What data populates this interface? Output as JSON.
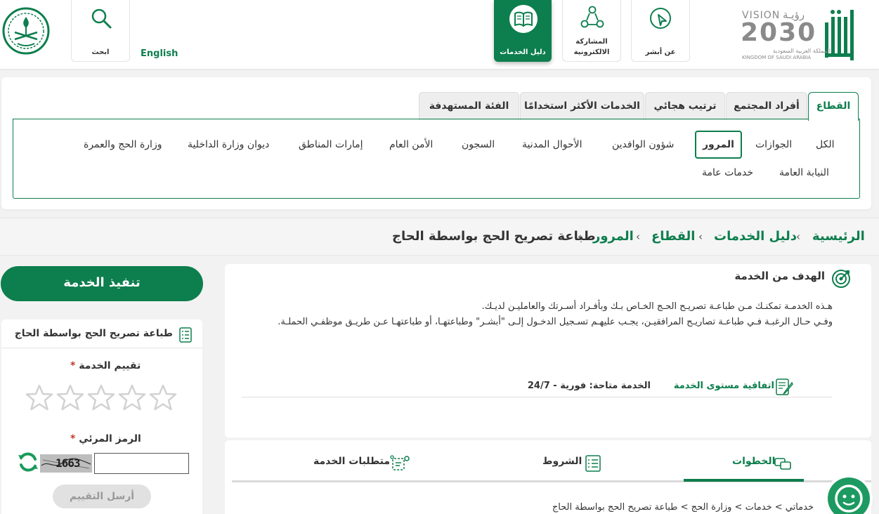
{
  "header": {
    "logo_vision": "VISION",
    "logo_year": "2030",
    "logo_kingdom_ar": "المملكة العربية السعودية",
    "logo_kingdom_en": "KINGDOM OF SAUDI ARABIA",
    "logo_vision_ar": "رؤيـة",
    "about_label": "عن أبشر",
    "participation_label_1": "المشاركة",
    "participation_label_2": "الالكترونية",
    "services_guide_label": "دليل الخدمات",
    "search_label": "ابحث",
    "english_label": "English"
  },
  "tabs": [
    {
      "label": "القطاع",
      "active": true
    },
    {
      "label": "أفراد المجتمع"
    },
    {
      "label": "ترتيب هجائي"
    },
    {
      "label": "الخدمات الأكثر استخدامًا"
    },
    {
      "label": "الفئة المستهدفة"
    }
  ],
  "sectors": [
    {
      "label": "الكل"
    },
    {
      "label": "الجوازات"
    },
    {
      "label": "المرور",
      "active": true
    },
    {
      "label": "شؤون الوافدين"
    },
    {
      "label": "الأحوال المدنية"
    },
    {
      "label": "السجون"
    },
    {
      "label": "الأمن العام"
    },
    {
      "label": "إمارات المناطق"
    },
    {
      "label": "ديوان وزارة الداخلية"
    },
    {
      "label": "وزارة الحج والعمرة"
    },
    {
      "label": "النيابة العامة"
    },
    {
      "label": "خدمات عامة"
    }
  ],
  "breadcrumb": {
    "home": "الرئيسية",
    "guide": "دليل الخدمات",
    "sector": "القطاع",
    "traffic": "المرور",
    "current": "طباعة تصريح الحج بواسطة الحاج",
    "separator": "‹"
  },
  "sidebar": {
    "execute_label": "تنفيذ الخدمة",
    "card_title": "طباعة تصريح الحج بواسطة الحاج",
    "rating_label": "تقييم الخدمة",
    "captcha_label": "الرمز المرئي",
    "required_mark": "*",
    "captcha_text": "1663",
    "captcha_value": "",
    "send_label": "أرسل التقييم",
    "rating_value": 0
  },
  "goal": {
    "title": "الهدف من الخدمة",
    "paragraph_1": "هـذه الخدمـة تمكنـك مـن طباعـة تصريـح الحـج الخـاص بـك وبأفـراد أسـرتك والعامليـن لديـك.",
    "paragraph_2": "وفـي حـال الرغبـة فـي طباعـة تصاريـح المرافقيـن، يجـب عليهـم تسـجيل الدخـول إلـى \"أبشـر\" وطباعتهـا، أو طباعتهـا عـن طريـق موظفـي الحملـة.",
    "sla_label": "اتفاقية مستوى الخدمة",
    "sla_value": "الخدمة متاحة: فورية - 24/7"
  },
  "steps_tabs": {
    "steps": "الخطوات",
    "conditions": "الشروط",
    "requirements": "متطلبات الخدمة",
    "path": "خدماتي > خدمات > وزارة الحج > طباعة تصريح الحج بواسطة الحاج"
  },
  "colors": {
    "primary": "#0d7e4d",
    "text": "#333333",
    "required": "#c0392b"
  }
}
